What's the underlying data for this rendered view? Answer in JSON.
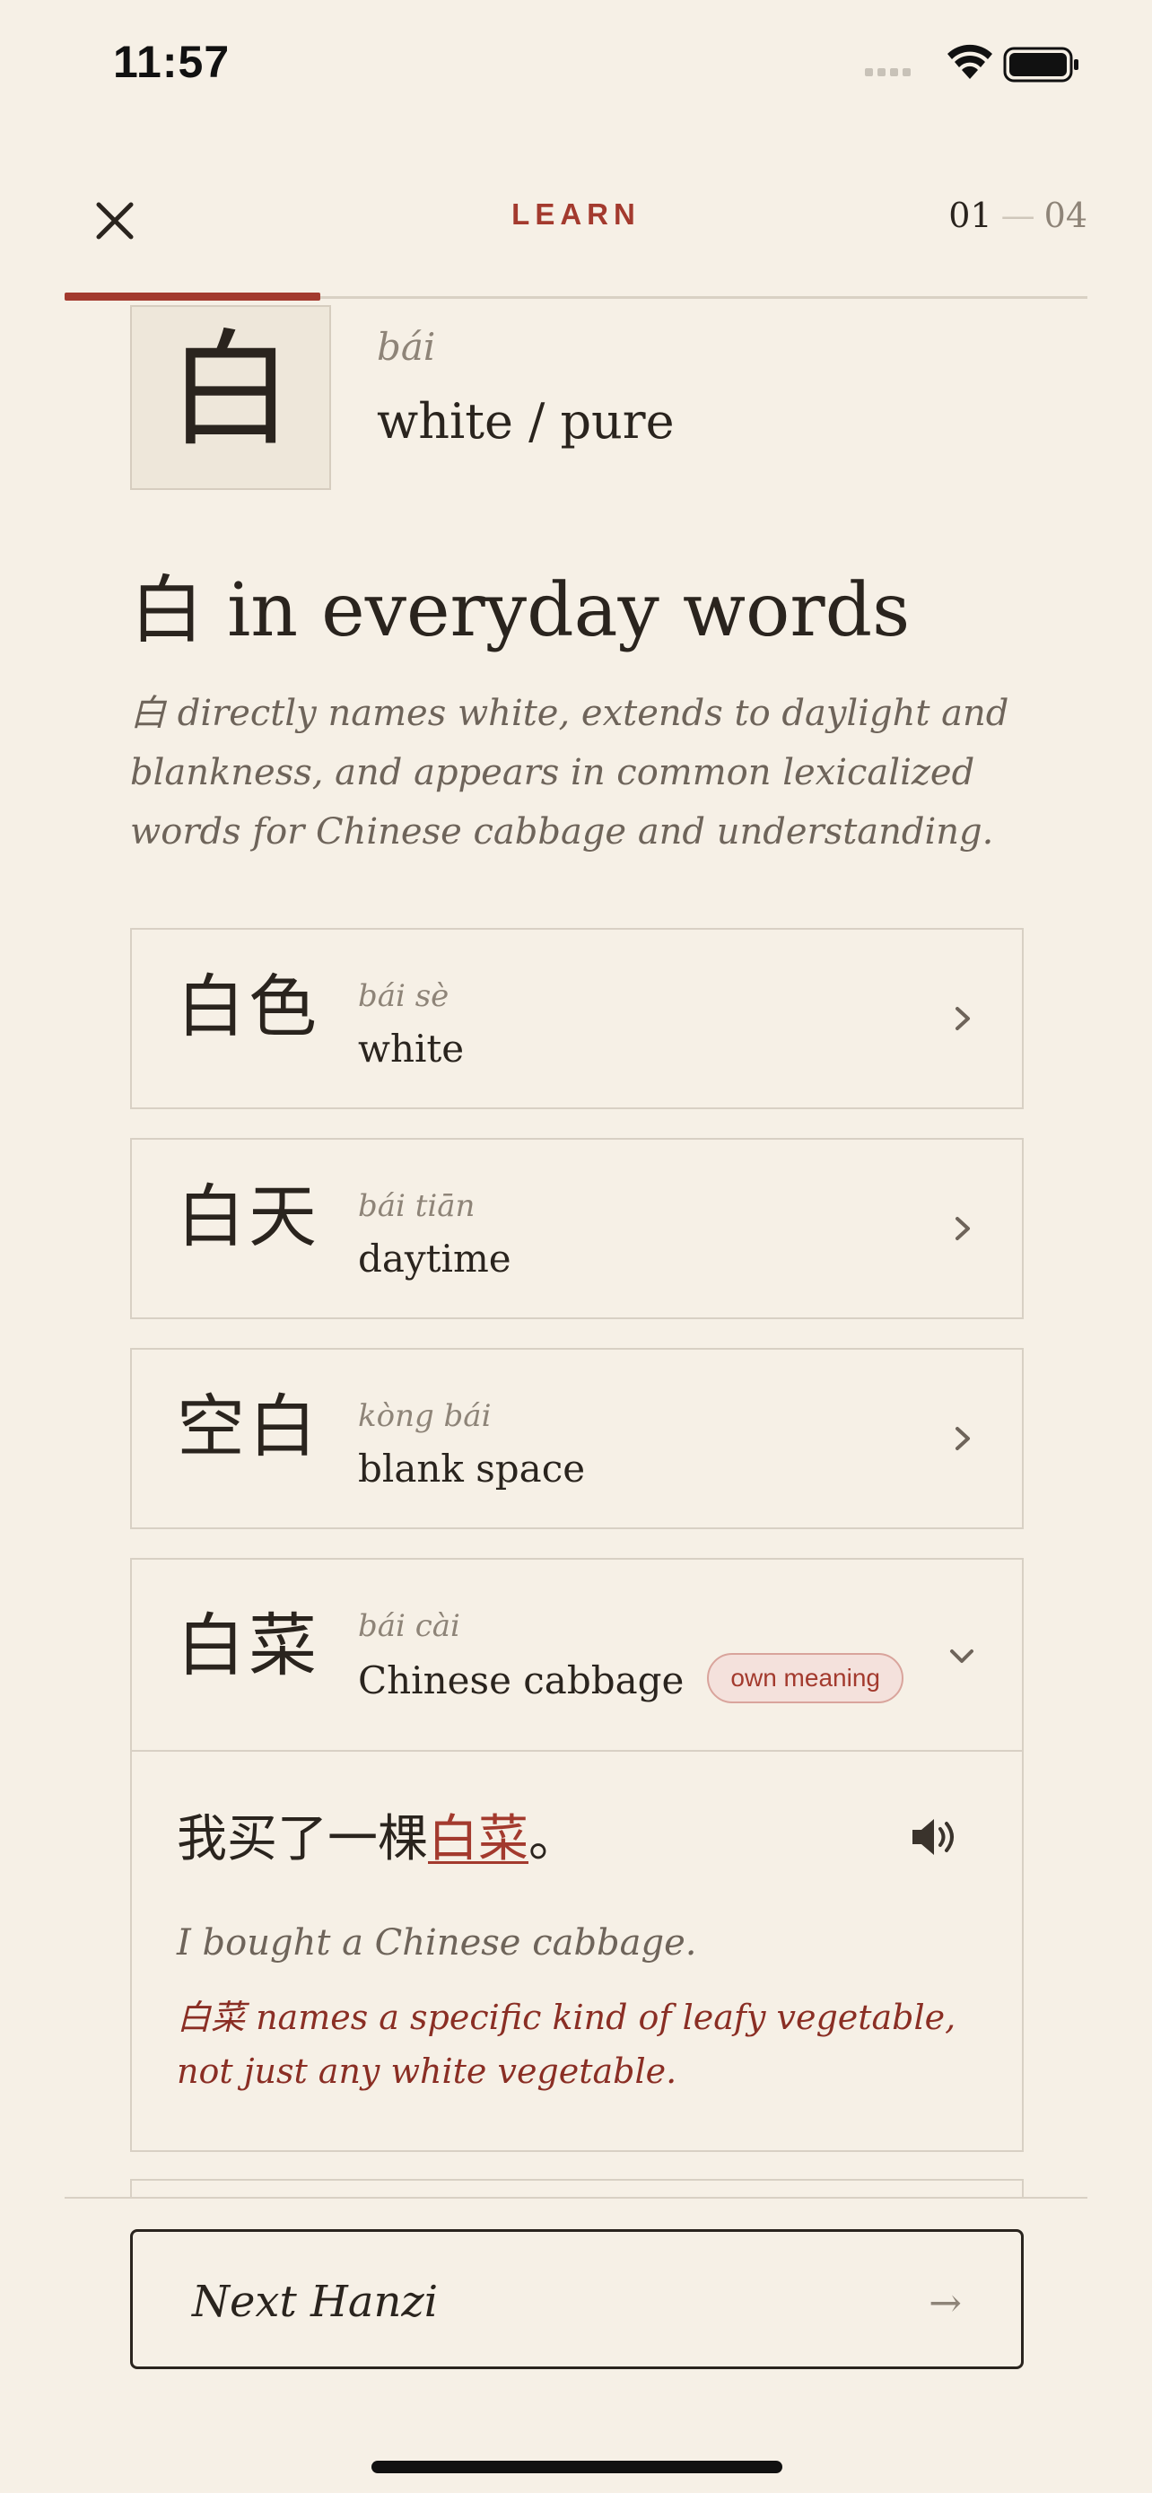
{
  "status_bar": {
    "time": "11:57"
  },
  "header": {
    "title": "LEARN",
    "step_current": "01",
    "step_separator": "—",
    "step_total": "04",
    "progress": 0.25
  },
  "hero": {
    "character": "白",
    "pinyin": "bái",
    "meaning": "white / pure"
  },
  "section": {
    "title": "白 in everyday words",
    "description": "白 directly names white, extends to daylight and blankness, and appears in common lexicalized words for Chinese cabbage and understanding."
  },
  "words": [
    {
      "hanzi": "白色",
      "pinyin": "bái sè",
      "meaning": "white"
    },
    {
      "hanzi": "白天",
      "pinyin": "bái tiān",
      "meaning": "daytime"
    },
    {
      "hanzi": "空白",
      "pinyin": "kòng bái",
      "meaning": "blank space"
    },
    {
      "hanzi": "白菜",
      "pinyin": "bái cài",
      "meaning": "Chinese cabbage",
      "badge": "own meaning",
      "example": {
        "before": "我买了一棵",
        "highlight": "白菜",
        "after": "。",
        "translation": "I bought a Chinese cabbage.",
        "note": "白菜 names a specific kind of leafy vegetable, not just any white vegetable."
      }
    }
  ],
  "footer": {
    "next_label": "Next Hanzi",
    "next_arrow": "→"
  },
  "colors": {
    "accent": "#A33A2E",
    "background": "#F6F0E6",
    "text": "#2A241E",
    "muted": "#8E8478"
  }
}
